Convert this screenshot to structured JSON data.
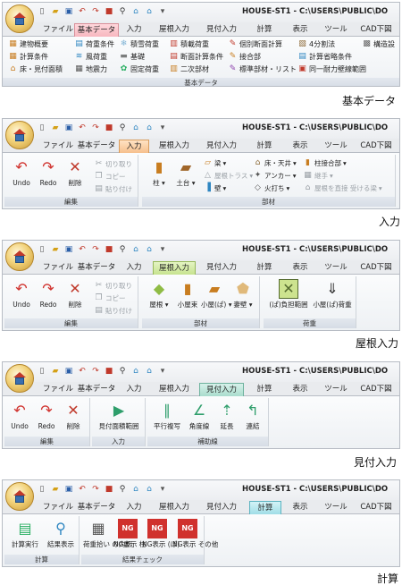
{
  "window_title": "HOUSE-ST1 - C:\\USERS\\PUBLIC\\DO",
  "tabs": [
    "ファイル",
    "基本データ",
    "入力",
    "屋根入力",
    "見付入力",
    "計算",
    "表示",
    "ツール",
    "CAD下図"
  ],
  "panels": {
    "kihon": {
      "caption": "基本データ",
      "group_label": "基本データ",
      "rows": [
        [
          "建物概要",
          "荷重条件",
          "積雪荷重",
          "積載荷重",
          "個別断面計算",
          "4分割法",
          "構造設"
        ],
        [
          "計算条件",
          "風荷重",
          "基礎",
          "断面計算条件",
          "接合部",
          "計算省略条件"
        ],
        [
          "床・見付面積",
          "地震力",
          "固定荷重",
          "二次部材",
          "標準部材・リスト",
          "同一耐力壁線範囲"
        ]
      ]
    },
    "nyuryoku": {
      "caption": "入力",
      "edit": {
        "label": "編集",
        "undo": "Undo",
        "redo": "Redo",
        "delete": "削除",
        "cut": "切り取り",
        "copy": "コピー",
        "paste": "貼り付け"
      },
      "buzai": {
        "label": "部材",
        "hashira": "柱",
        "dodai": "土台",
        "col1": [
          "梁",
          "屋根トラス",
          "壁"
        ],
        "col2": [
          "床・天井",
          "アンカー",
          "火打ち"
        ],
        "col3": [
          "柱接合部",
          "継手",
          "屋根を直接 受ける梁"
        ]
      }
    },
    "yane": {
      "caption": "屋根入力",
      "edit": {
        "label": "編集",
        "undo": "Undo",
        "redo": "Redo",
        "delete": "削除",
        "cut": "切り取り",
        "copy": "コピー",
        "paste": "貼り付け"
      },
      "buzai": {
        "label": "部材",
        "items": [
          "屋根",
          "小屋束",
          "小屋(ぱ)",
          "妻壁"
        ]
      },
      "kaju": {
        "label": "荷重",
        "items": [
          "(ぱ)負担範囲",
          "小屋(ぱ)荷重"
        ]
      }
    },
    "mitsuke": {
      "caption": "見付入力",
      "edit": {
        "label": "編集",
        "undo": "Undo",
        "redo": "Redo",
        "delete": "削除"
      },
      "nyuryoku": {
        "label": "入力",
        "item": "見付面積範囲"
      },
      "hojo": {
        "label": "補助線",
        "items": [
          "平行複写",
          "角度線",
          "延長",
          "連結"
        ]
      }
    },
    "keisan": {
      "caption": "計算",
      "keisan": {
        "label": "計算",
        "items": [
          "計算実行",
          "結果表示"
        ]
      },
      "check": {
        "label": "結果チェック",
        "items": [
          "荷重拾い の内訳",
          "NG表示 柱",
          "NG表示 (ぱ)",
          "NG表示 その他"
        ]
      }
    }
  }
}
